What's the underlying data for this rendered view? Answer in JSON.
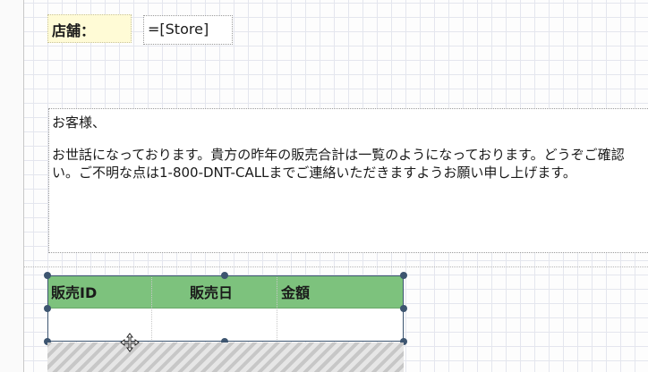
{
  "store": {
    "label": "店舗：",
    "field_value": "=[Store]"
  },
  "message": {
    "greeting": "お客様、",
    "line1": "お世話になっております。貴方の昨年の販売合計は一覧のようになっております。どうぞご確認",
    "line2": "い。ご不明な点は1-800-DNT-CALLまでご連絡いただきますようお願い申し上げます。"
  },
  "table": {
    "headers": [
      "販売ID",
      "販売日",
      "金額"
    ]
  },
  "colors": {
    "header_bg": "#7dc27d",
    "label_bg": "#fffbd6",
    "selection": "#3d5570"
  },
  "icons": {
    "move_cursor": "move-cursor-icon"
  }
}
